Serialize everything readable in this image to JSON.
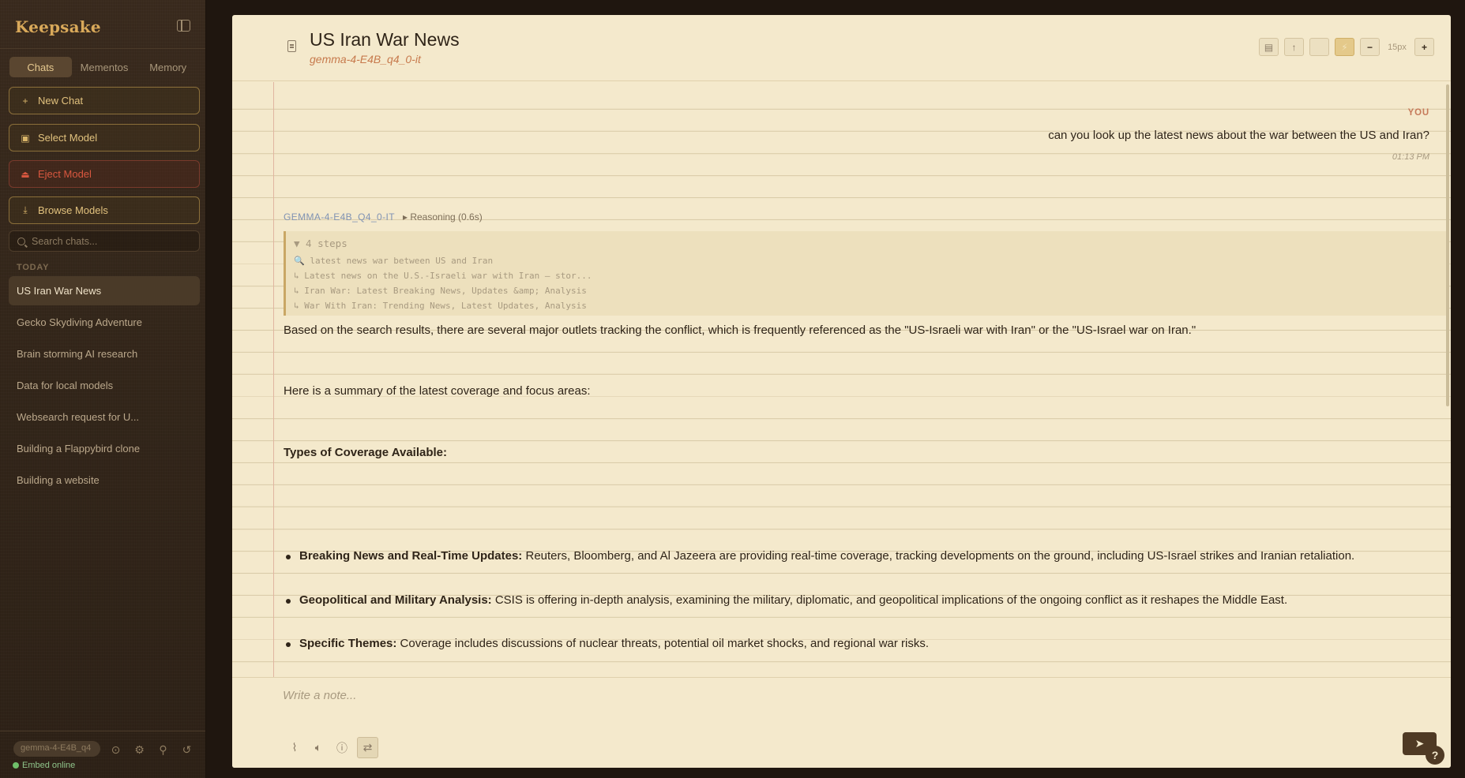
{
  "sidebar": {
    "brand": "Keepsake",
    "tabs": [
      {
        "label": "Chats",
        "active": true
      },
      {
        "label": "Mementos",
        "active": false
      },
      {
        "label": "Memory",
        "active": false
      }
    ],
    "buttons": {
      "new_chat": "New Chat",
      "select_model": "Select Model",
      "eject_model": "Eject Model",
      "browse_models": "Browse Models"
    },
    "search_placeholder": "Search chats...",
    "section_label": "TODAY",
    "chats": [
      "US Iran War News",
      "Gecko Skydiving Adventure",
      "Brain storming AI research",
      "Data for local models",
      "Websearch request for U...",
      "Building a Flappybird clone",
      "Building a website"
    ],
    "active_chat": 0,
    "footer": {
      "model": "gemma-4-E4B_q4",
      "status": "Embed online"
    }
  },
  "header": {
    "title": "US Iran War News",
    "model": "gemma-4-E4B_q4_0-it",
    "font_size": "15px"
  },
  "messages": {
    "user": {
      "label": "YOU",
      "text": "can you look up the latest news about the war between the US and Iran?",
      "time": "01:13 PM"
    },
    "assistant": {
      "name": "GEMMA-4-E4B_Q4_0-IT",
      "reasoning": "▸ Reasoning (0.6s)",
      "steps_header": "▼ 4 steps",
      "steps": [
        "🔍 latest news war between US and Iran",
        "↳ Latest news on the U.S.-Israeli war with Iran — stor...",
        "↳ Iran War: Latest Breaking News, Updates &amp; Analysis",
        "↳ War With Iran: Trending News, Latest Updates, Analysis"
      ],
      "intro": "Based on the search results, there are several major outlets tracking the conflict, which is frequently referenced as the \"US-Israeli war with Iran\" or the \"US-Israel war on Iran.\"",
      "summary": "Here is a summary of the latest coverage and focus areas:",
      "heading": "Types of Coverage Available:",
      "bullets": [
        {
          "title": "Breaking News and Real-Time Updates:",
          "text": " Reuters, Bloomberg, and Al Jazeera are providing real-time coverage, tracking developments on the ground, including US-Israel strikes and Iranian retaliation."
        },
        {
          "title": "Geopolitical and Military Analysis:",
          "text": " CSIS is offering in-depth analysis, examining the military, diplomatic, and geopolitical implications of the ongoing conflict as it reshapes the Middle East."
        },
        {
          "title": "Specific Themes:",
          "text": " Coverage includes discussions of nuclear threats, potential oil market shocks, and regional war risks."
        }
      ]
    }
  },
  "compose": {
    "placeholder": "Write a note...",
    "help": "?"
  },
  "icons": {
    "new_chat": "plus-icon",
    "select_model": "chip-icon",
    "eject_model": "eject-icon",
    "browse_models": "download-icon",
    "send": "send-icon"
  }
}
